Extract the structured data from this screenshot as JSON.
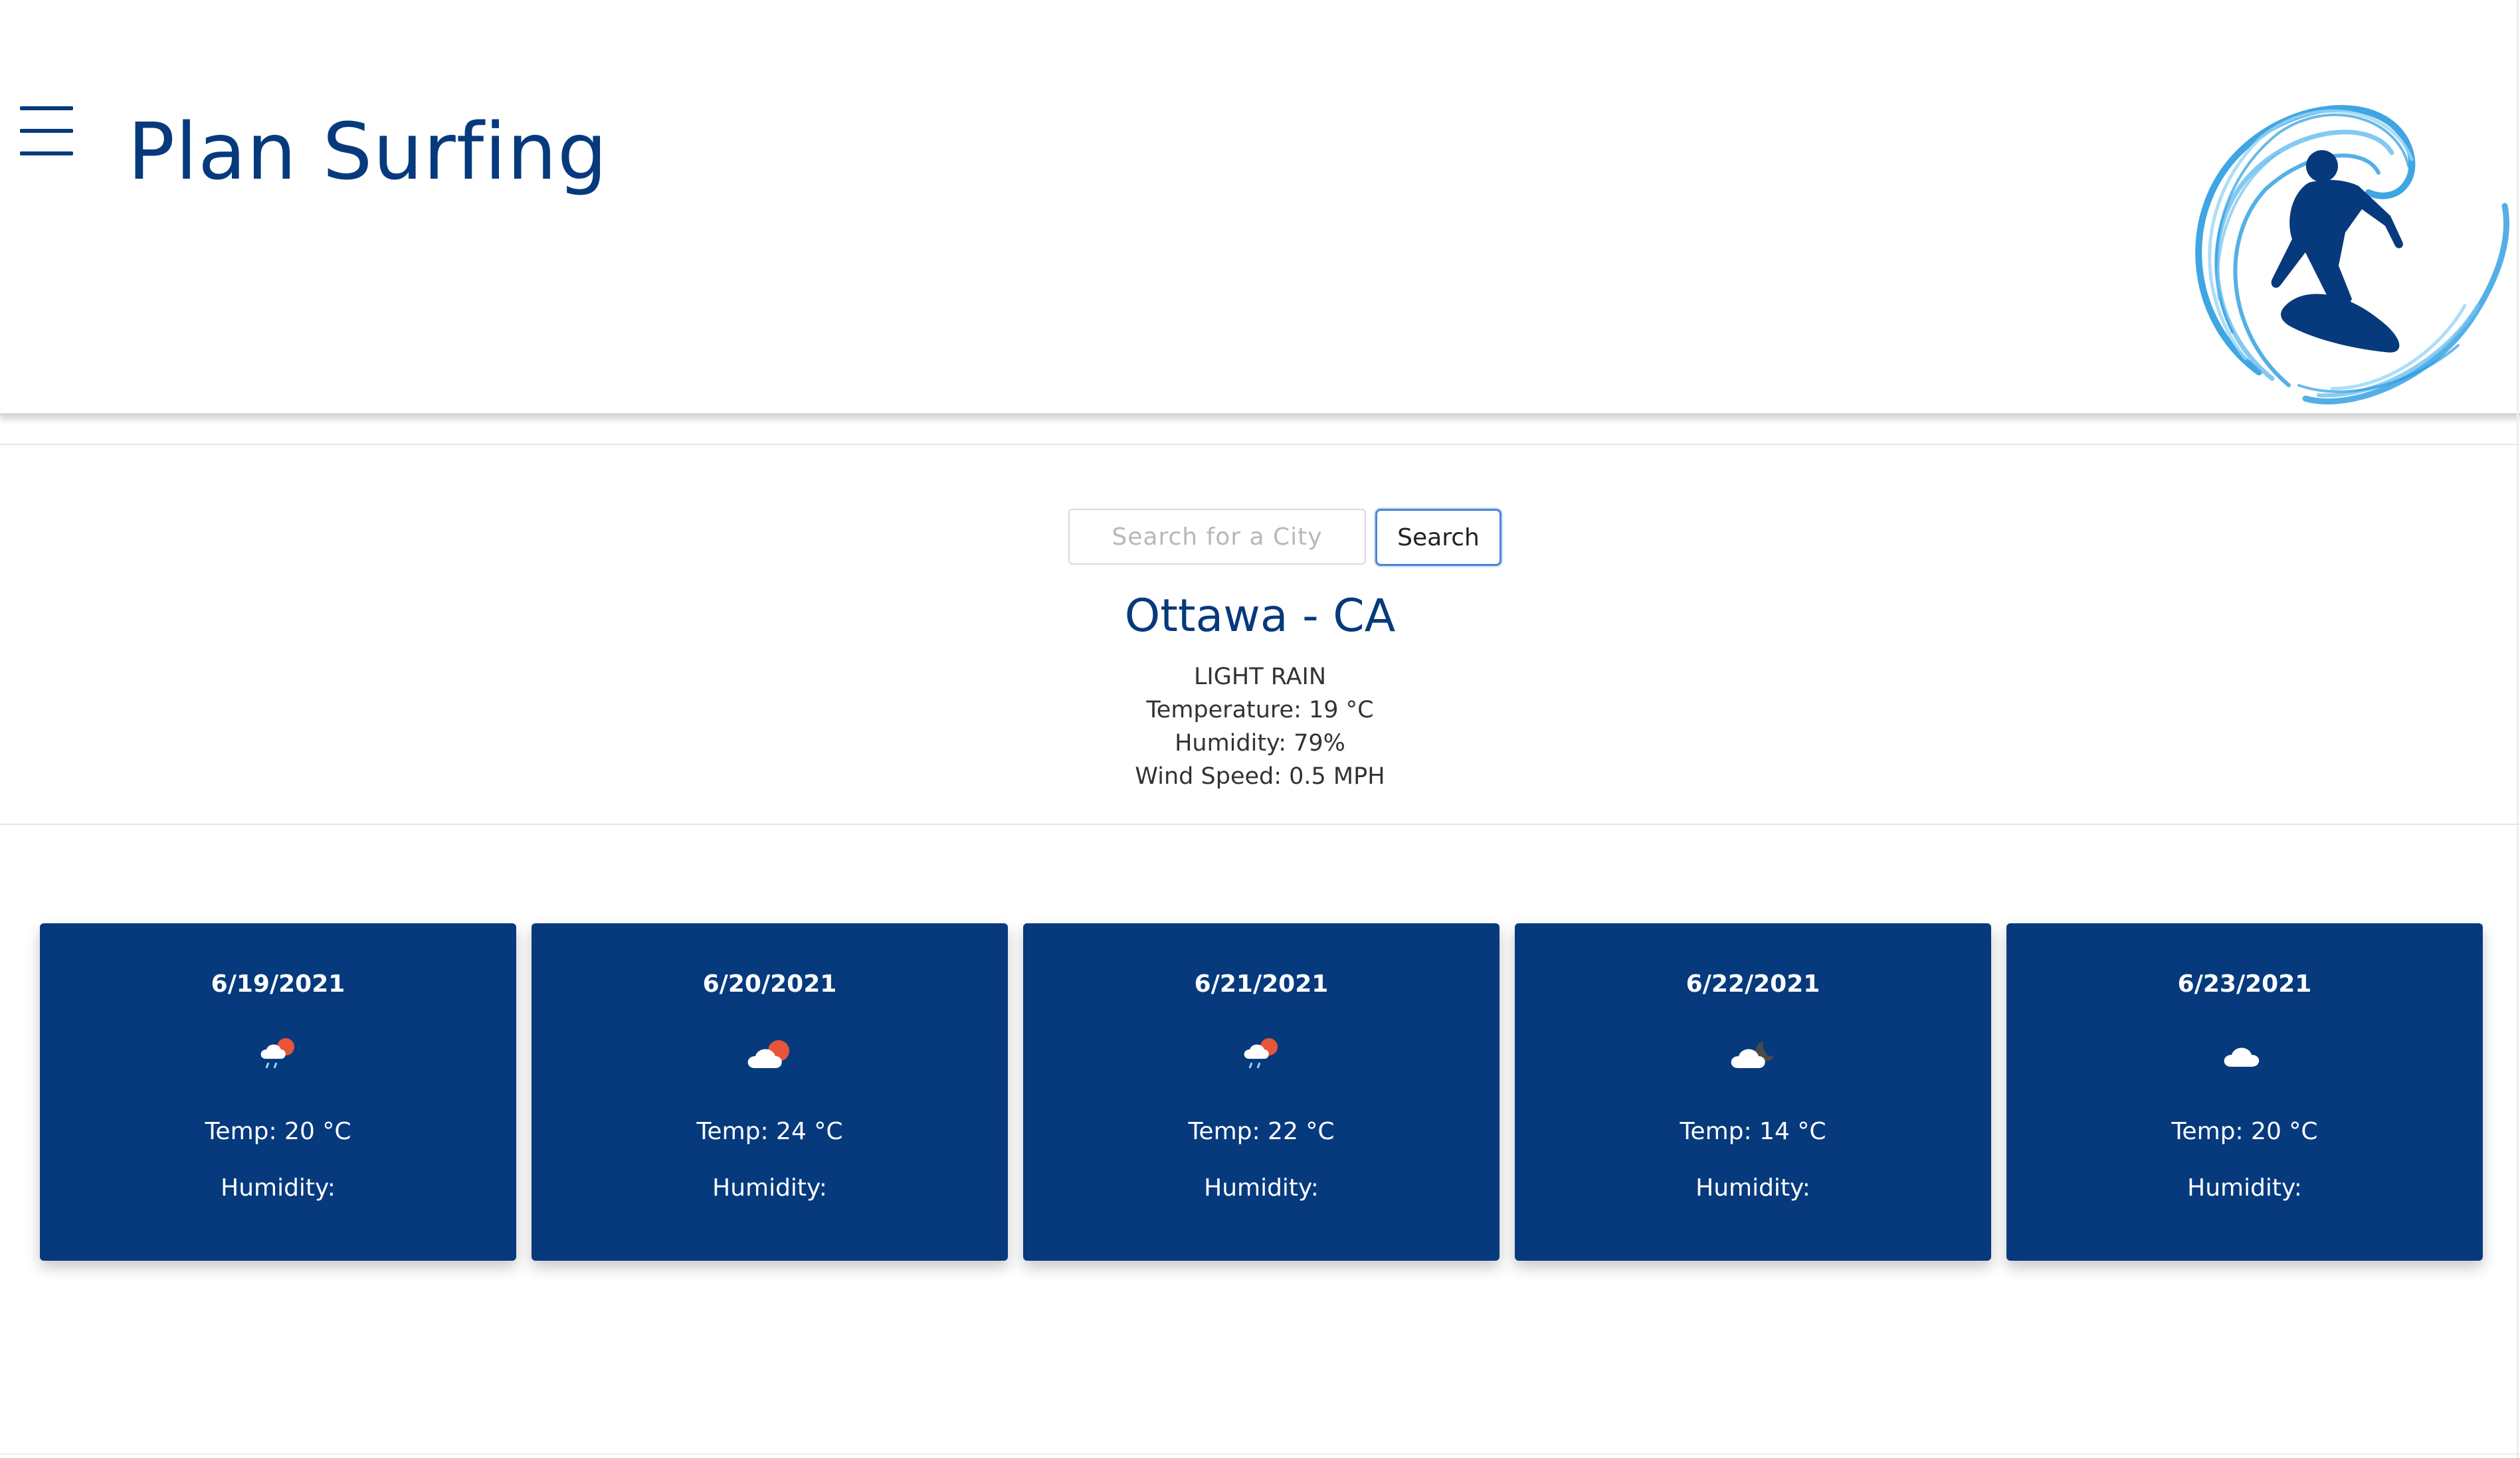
{
  "header": {
    "title": "Plan Surfing",
    "menu_icon": "hamburger-icon",
    "logo_icon": "surfer-wave-logo"
  },
  "search": {
    "placeholder": "Search for a City",
    "value": "",
    "button_label": "Search"
  },
  "current": {
    "city": "Ottawa - CA",
    "condition": "LIGHT RAIN",
    "temperature": "Temperature: 19 °C",
    "humidity": "Humidity: 79%",
    "wind": "Wind Speed: 0.5 MPH"
  },
  "forecast": [
    {
      "date": "6/19/2021",
      "icon": "light-rain-sun-icon",
      "temp": "Temp: 20 °C",
      "humidity": "Humidity:"
    },
    {
      "date": "6/20/2021",
      "icon": "partly-cloudy-day-icon",
      "temp": "Temp: 24 °C",
      "humidity": "Humidity:"
    },
    {
      "date": "6/21/2021",
      "icon": "light-rain-sun-icon",
      "temp": "Temp: 22 °C",
      "humidity": "Humidity:"
    },
    {
      "date": "6/22/2021",
      "icon": "partly-cloudy-night-icon",
      "temp": "Temp: 14 °C",
      "humidity": "Humidity:"
    },
    {
      "date": "6/23/2021",
      "icon": "cloud-icon",
      "temp": "Temp: 20 °C",
      "humidity": "Humidity:"
    }
  ],
  "colors": {
    "brand": "#063a7d",
    "accent": "#2a9be0",
    "card_text": "#ffffff"
  }
}
